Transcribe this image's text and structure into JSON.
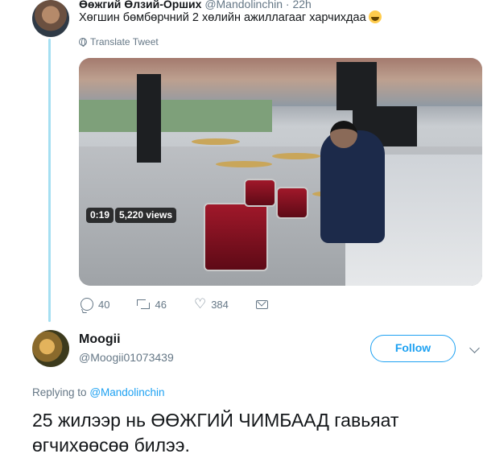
{
  "original_tweet": {
    "display_name": "Өөжгий Өлзий-Орших",
    "handle": "@Mandolinchin",
    "separator": "·",
    "time": "22h",
    "text": "Хөгшин бөмбөрчний 2 хөлийн ажиллагааг харчихдаа",
    "emoji": "face-with-tears-of-joy",
    "translate_label": "Translate Tweet",
    "video": {
      "duration": "0:19",
      "views": "5,220 views"
    },
    "actions": {
      "replies": "40",
      "retweets": "46",
      "likes": "384"
    }
  },
  "reply_tweet": {
    "display_name": "Moogii",
    "handle": "@Moogii01073439",
    "follow_label": "Follow",
    "replying_prefix": "Replying to",
    "replying_to": "@Mandolinchin",
    "text": "25 жилээр нь ӨӨЖГИЙ ЧИМБААД гавьяат өгчихөөсөө билээ."
  },
  "colors": {
    "accent": "#1da1f2",
    "muted": "#657786",
    "thread_line": "#a5dff2"
  },
  "icons": [
    "globe-icon",
    "reply-icon",
    "retweet-icon",
    "heart-icon",
    "mail-icon",
    "chevron-down-icon"
  ]
}
